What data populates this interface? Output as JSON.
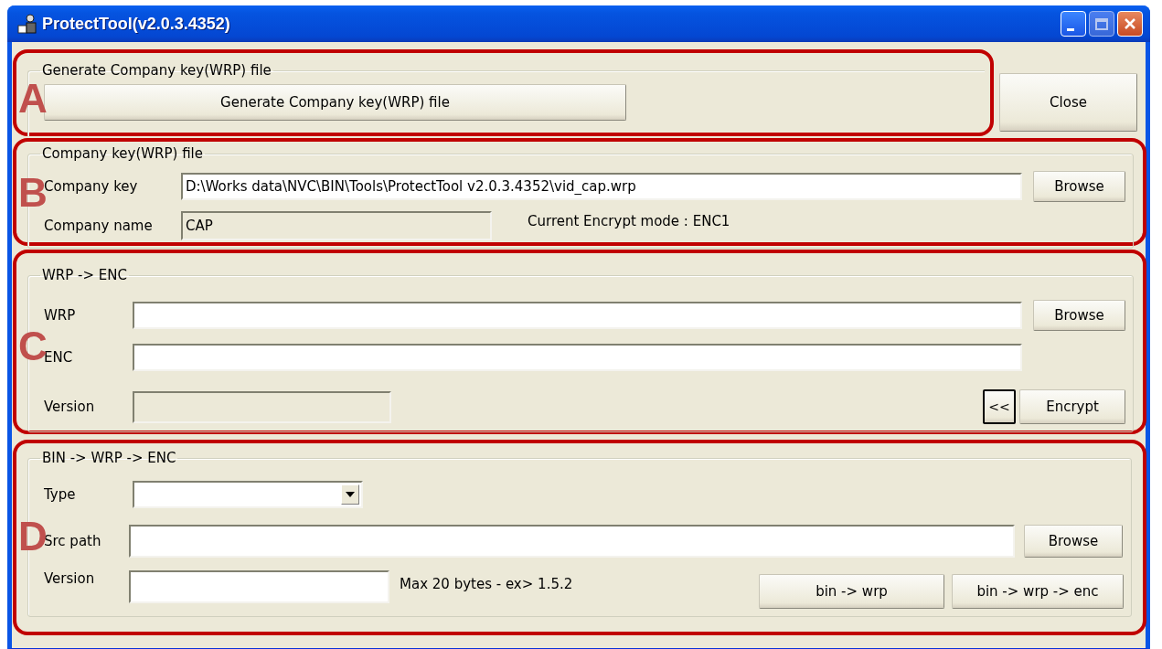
{
  "window": {
    "title": "ProtectTool(v2.0.3.4352)"
  },
  "close_button": "Close",
  "sections": [
    {
      "kind": "generate",
      "marker": "A",
      "title": "Generate Company key(WRP) file",
      "button": "Generate Company key(WRP) file"
    },
    {
      "kind": "key",
      "marker": "B",
      "title": "Company key(WRP) file",
      "key_field": {
        "label": "Company key",
        "value": "D:\\Works data\\NVC\\BIN\\Tools\\ProtectTool v2.0.3.4352\\vid_cap.wrp",
        "disabled": false
      },
      "browse": "Browse",
      "name_field": {
        "label": "Company name",
        "value": "CAP",
        "disabled": true
      },
      "mode_text": "Current Encrypt mode : ENC1"
    },
    {
      "kind": "encrypt",
      "marker": "C",
      "title": "WRP -> ENC",
      "wrp_field": {
        "label": "WRP",
        "disabled": false
      },
      "browse": "Browse",
      "enc_field": {
        "label": "ENC",
        "disabled": false
      },
      "version_field": {
        "label": "Version",
        "disabled": true
      },
      "back_button": {
        "label": "<<",
        "focused": true
      },
      "encrypt_button": "Encrypt"
    },
    {
      "kind": "build",
      "marker": "D",
      "title": "BIN -> WRP -> ENC",
      "type_field": {
        "label": "Type",
        "disabled": false
      },
      "src_field": {
        "label": "Src path",
        "disabled": false
      },
      "browse": "Browse",
      "version_field": {
        "label": "Version",
        "disabled": false
      },
      "version_hint": "Max 20 bytes - ex> 1.5.2",
      "buttons": [
        "bin -> wrp",
        "bin -> wrp -> enc"
      ]
    }
  ]
}
